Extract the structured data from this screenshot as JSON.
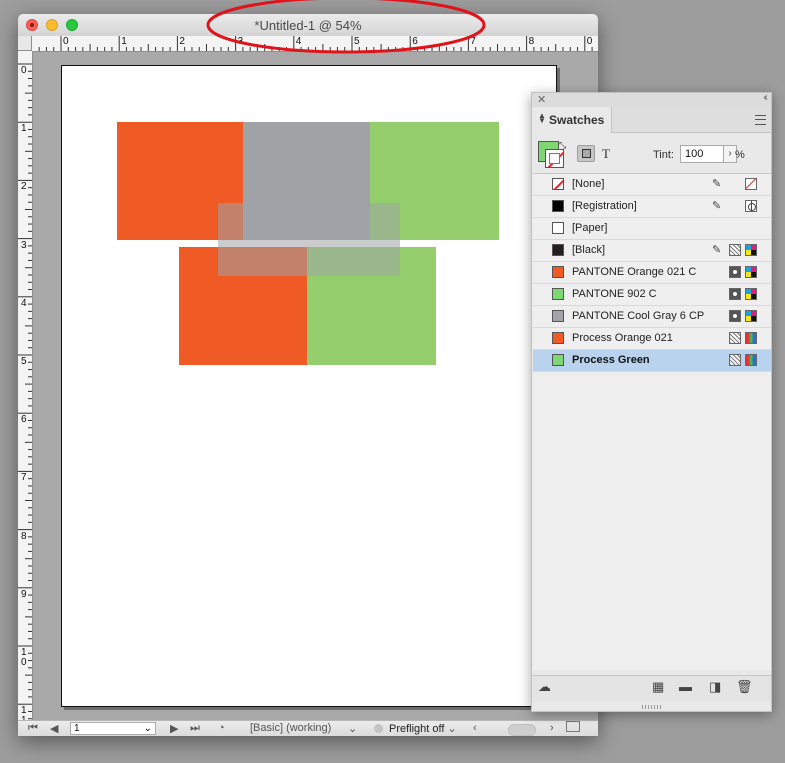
{
  "window": {
    "title": "*Untitled-1 @ 54%"
  },
  "rulers": {
    "horizontal_labels": [
      "0",
      "1",
      "2",
      "3",
      "4",
      "5",
      "6",
      "7",
      "8",
      "0"
    ],
    "vertical_labels": [
      "0",
      "1",
      "2",
      "3",
      "4",
      "5",
      "6",
      "7",
      "8",
      "9",
      "1\n0",
      "1\n1"
    ]
  },
  "status_bar": {
    "page_number": "1",
    "workspace": "[Basic] (working)",
    "preflight": "Preflight off"
  },
  "panel": {
    "tab_label": "Swatches",
    "tint_label": "Tint:",
    "tint_value": "100",
    "tint_unit": "%",
    "text_mode_label": "T",
    "selected_fill_color": "#7fd774",
    "swatches": [
      {
        "name": "[None]",
        "color": "none",
        "icons": [
          "noedit-icon",
          "none-icon"
        ]
      },
      {
        "name": "[Registration]",
        "color": "#000000",
        "icons": [
          "noedit-icon",
          "registration-icon"
        ]
      },
      {
        "name": "[Paper]",
        "color": "#ffffff",
        "icons": []
      },
      {
        "name": "[Black]",
        "color": "#231f20",
        "icons": [
          "noedit-icon",
          "process-icon",
          "cmyk-icon"
        ]
      },
      {
        "name": "PANTONE Orange 021 C",
        "color": "#f15a24",
        "icons": [
          "spot-icon",
          "cmyk-icon"
        ]
      },
      {
        "name": "PANTONE 902 C",
        "color": "#7fd774",
        "icons": [
          "spot-icon",
          "cmyk-icon"
        ]
      },
      {
        "name": "PANTONE Cool Gray 6 CP",
        "color": "#a3a4a7",
        "icons": [
          "spot-icon",
          "cmyk-icon"
        ]
      },
      {
        "name": "Process Orange 021",
        "color": "#f15a24",
        "icons": [
          "process-icon",
          "rgb-icon"
        ]
      },
      {
        "name": "Process Green",
        "color": "#7fd774",
        "icons": [
          "process-icon",
          "rgb-icon"
        ],
        "selected": true
      }
    ]
  },
  "canvas_colors": {
    "orange": "#f05a24",
    "gray": "#9fa3a6",
    "green": "#94ce6c",
    "overlay_gray": "#9fa3a6",
    "annotation": "#e0131b"
  }
}
